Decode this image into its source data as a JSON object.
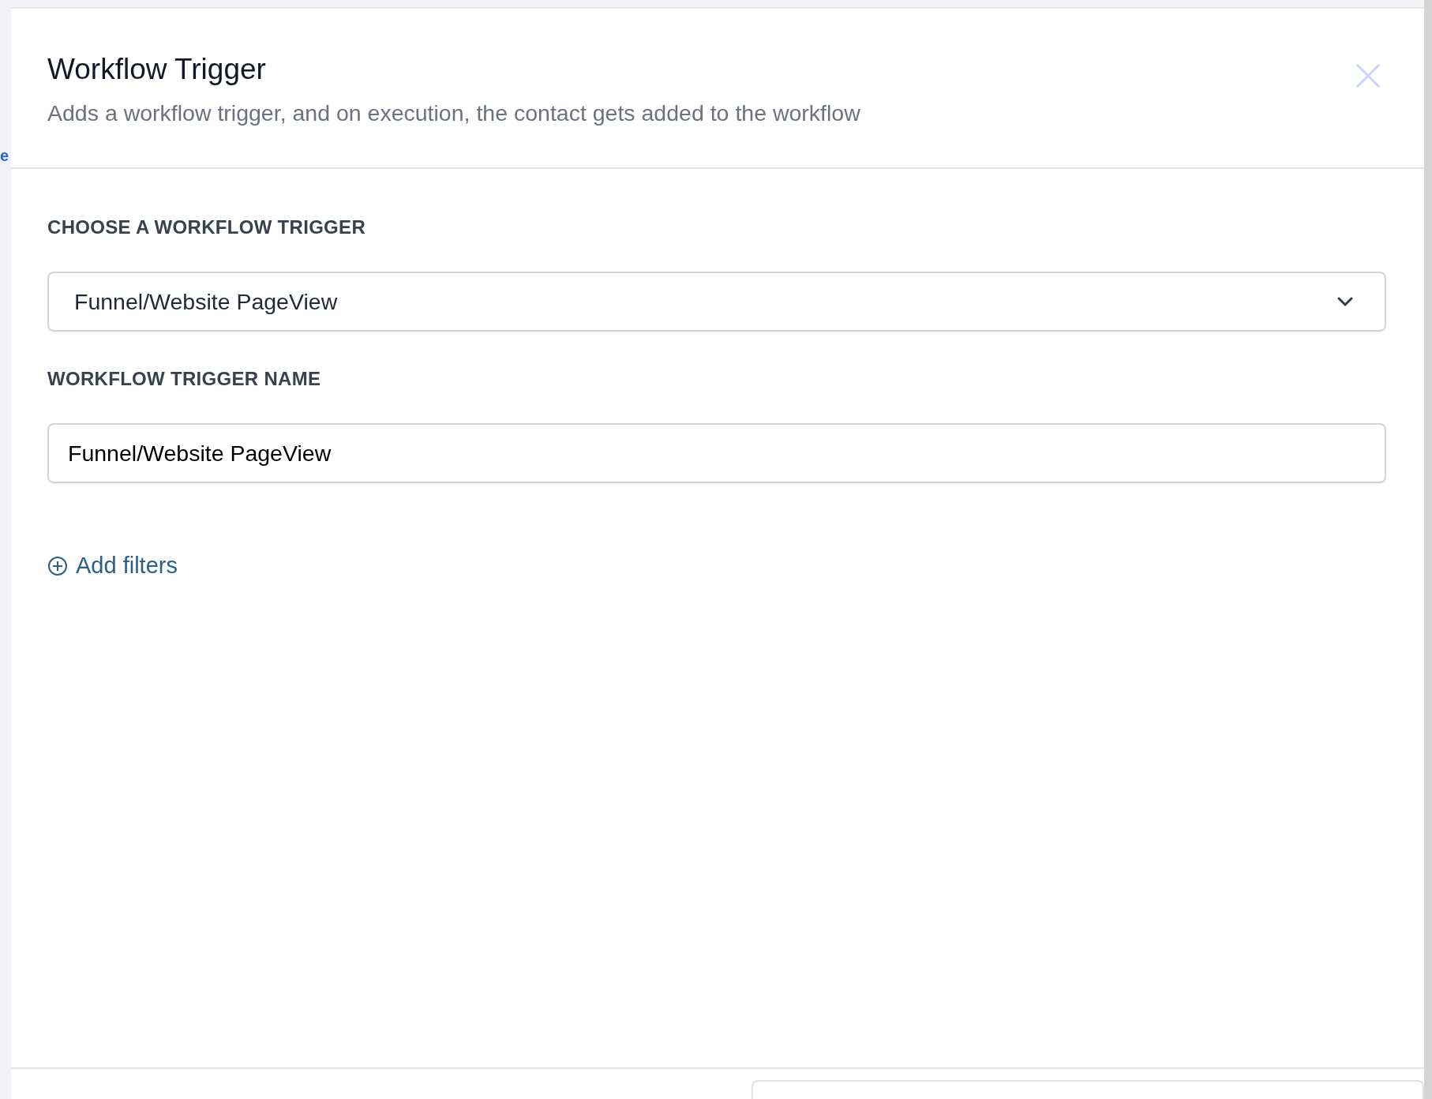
{
  "background": {
    "fragment": "e"
  },
  "panel": {
    "title": "Workflow Trigger",
    "subtitle": "Adds a workflow trigger, and on execution, the contact gets added to the workflow"
  },
  "fields": [
    {
      "kind": "select",
      "label": "CHOOSE A WORKFLOW TRIGGER",
      "value": "Funnel/Website PageView"
    },
    {
      "kind": "text",
      "label": "WORKFLOW TRIGGER NAME",
      "value": "Funnel/Website PageView"
    }
  ],
  "add_filters": {
    "label": "Add filters"
  }
}
